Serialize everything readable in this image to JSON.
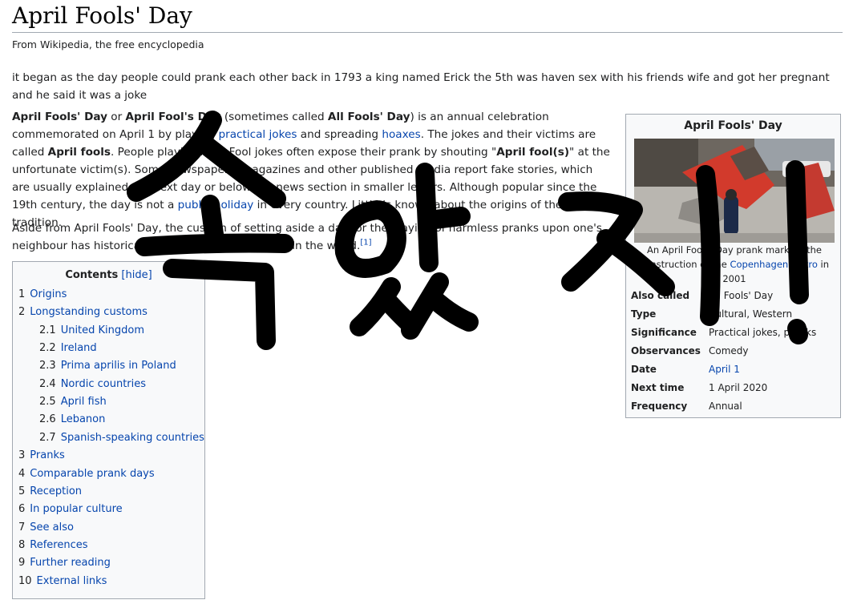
{
  "page": {
    "title": "April Fools' Day",
    "tagline": "From Wikipedia, the free encyclopedia"
  },
  "vandal_text": "it began as the day people could prank each other back in 1793 a king named Erick the 5th was haven sex with his friends wife and got her pregnant and he said it was a joke",
  "lead": {
    "b1": "April Fools' Day",
    "t1": " or ",
    "b2": "April Fool's Day",
    "t2": " (sometimes called ",
    "b3": "All Fools' Day",
    "t3": ") is an annual celebration commemorated on April 1 by playing ",
    "link1": "practical jokes",
    "t4": " and spreading ",
    "link2": "hoaxes",
    "t5": ". The jokes and their victims are called ",
    "b4": "April fools",
    "t6": ". People playing April Fool jokes often expose their prank by shouting \"",
    "b5": "April fool(s)",
    "t7": "\" at the unfortunate victim(s). Some newspapers, magazines and other published media report fake stories, which are usually explained the next day or below the news section in smaller letters. Although popular since the 19th century, the day is not a ",
    "link3": "public holiday",
    "t8": " in every country. Little is known about the origins of the tradition."
  },
  "aside": {
    "text": "Aside from April Fools' Day, the custom of setting aside a day for the playing of harmless pranks upon one's neighbour has historically been relatively common in the world.",
    "ref": "[1]"
  },
  "infobox": {
    "title": "April Fools' Day",
    "caption_pre": "An April Fools' Day prank marking the construction of the ",
    "caption_link": "Copenhagen Metro",
    "caption_post": " in 2001",
    "rows": [
      {
        "label": "Also called",
        "value": "All Fools' Day",
        "is_link": false
      },
      {
        "label": "Type",
        "value": "Cultural, Western",
        "is_link": false
      },
      {
        "label": "Significance",
        "value": "Practical jokes, pranks",
        "is_link": false
      },
      {
        "label": "Observances",
        "value": "Comedy",
        "is_link": false
      },
      {
        "label": "Date",
        "value": "April 1",
        "is_link": true
      },
      {
        "label": "Next time",
        "value": "1 April 2020",
        "is_link": false
      },
      {
        "label": "Frequency",
        "value": "Annual",
        "is_link": false
      }
    ]
  },
  "toc": {
    "title": "Contents",
    "toggle": "[hide]",
    "items": [
      {
        "num": "1",
        "label": "Origins",
        "level": 1
      },
      {
        "num": "2",
        "label": "Longstanding customs",
        "level": 1
      },
      {
        "num": "2.1",
        "label": "United Kingdom",
        "level": 2
      },
      {
        "num": "2.2",
        "label": "Ireland",
        "level": 2
      },
      {
        "num": "2.3",
        "label": "Prima aprilis in Poland",
        "level": 2
      },
      {
        "num": "2.4",
        "label": "Nordic countries",
        "level": 2
      },
      {
        "num": "2.5",
        "label": "April fish",
        "level": 2
      },
      {
        "num": "2.6",
        "label": "Lebanon",
        "level": 2
      },
      {
        "num": "2.7",
        "label": "Spanish-speaking countries",
        "level": 2
      },
      {
        "num": "3",
        "label": "Pranks",
        "level": 1
      },
      {
        "num": "4",
        "label": "Comparable prank days",
        "level": 1
      },
      {
        "num": "5",
        "label": "Reception",
        "level": 1
      },
      {
        "num": "6",
        "label": "In popular culture",
        "level": 1
      },
      {
        "num": "7",
        "label": "See also",
        "level": 1
      },
      {
        "num": "8",
        "label": "References",
        "level": 1
      },
      {
        "num": "9",
        "label": "Further reading",
        "level": 1
      },
      {
        "num": "10",
        "label": "External links",
        "level": 1
      }
    ]
  },
  "overlay": {
    "handwriting": "속았지!",
    "color": "#000000"
  },
  "colors": {
    "link": "#0645ad",
    "text": "#202122",
    "border": "#a2a9b1",
    "box_bg": "#f8f9fa"
  }
}
